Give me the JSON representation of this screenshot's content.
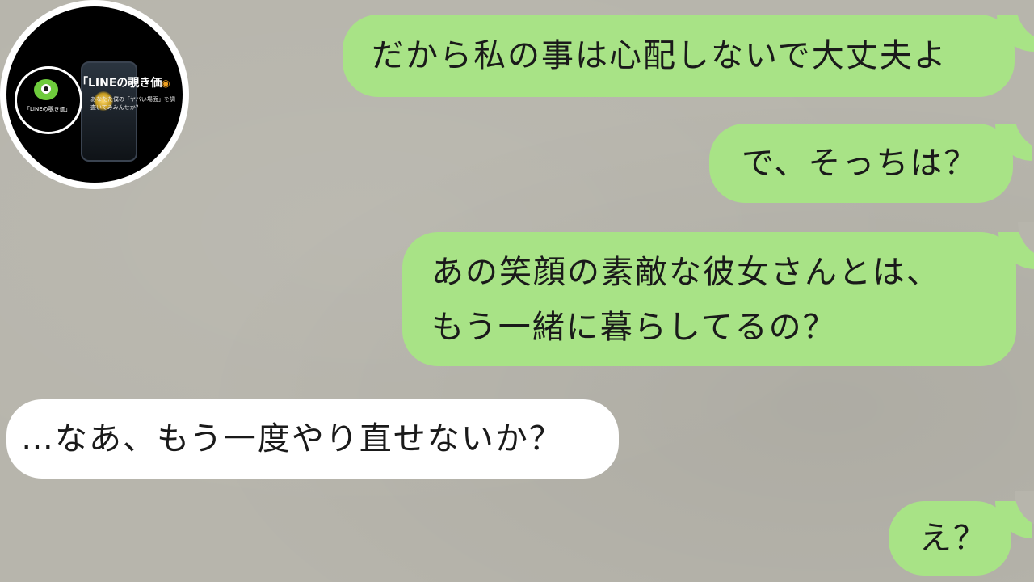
{
  "chat": {
    "messages": [
      {
        "side": "sent",
        "text": "だから私の事は心配しないで大丈夫よ"
      },
      {
        "side": "sent",
        "text": "で、そっちは？"
      },
      {
        "side": "sent",
        "lines": [
          "あの笑顔の素敵な彼女さんとは、",
          "もう一緒に暮らしてるの？"
        ]
      },
      {
        "side": "received",
        "text": "…なあ、もう一度やり直せないか？"
      },
      {
        "side": "sent",
        "text": "え？"
      }
    ]
  },
  "badge": {
    "title": "「LINEの覗き価",
    "subtitle": "あなたた僕の「ヤバい場面」を調査いてみみんせか？",
    "ring_label": "「LINEの覗き価」",
    "icon": "eye-icon"
  },
  "colors": {
    "background": "#b7b5ac",
    "sent_bubble": "#a8e386",
    "received_bubble": "#ffffff"
  }
}
